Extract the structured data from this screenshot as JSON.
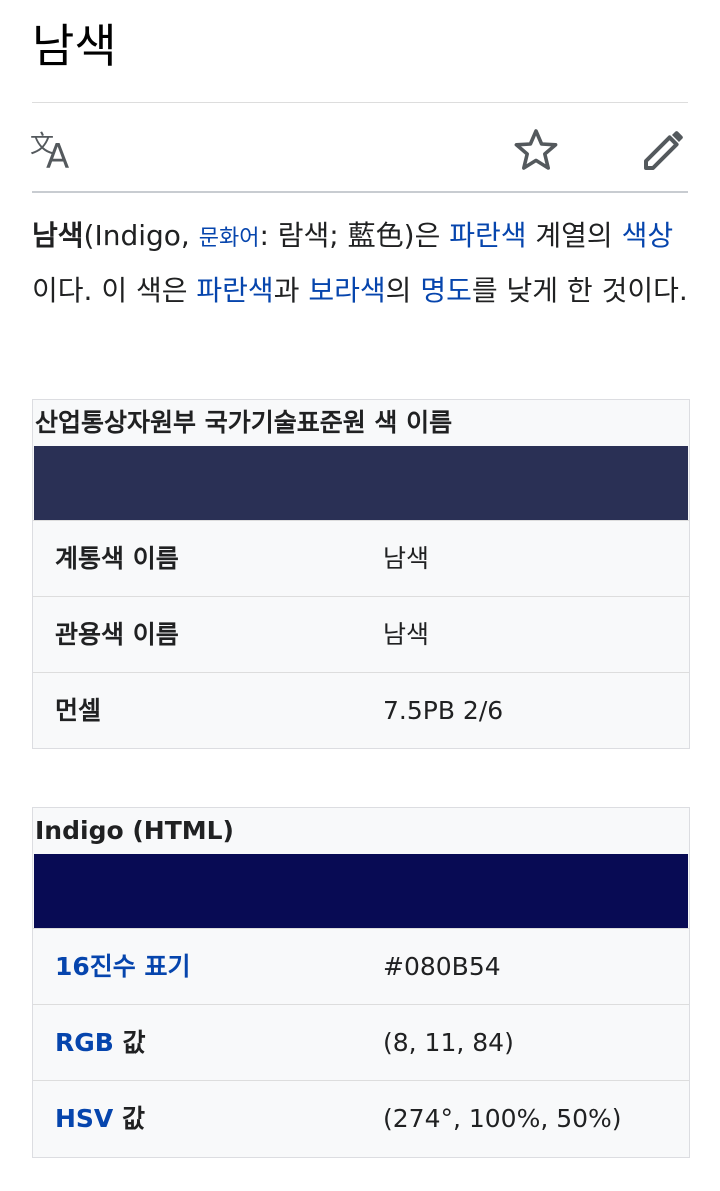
{
  "page": {
    "title": "남색"
  },
  "toolbar": {
    "language_icon": "translate-icon",
    "watch_icon": "star-icon",
    "edit_icon": "pencil-icon"
  },
  "intro": {
    "term": "남색",
    "open": "(Indigo, ",
    "munhwa_label": "문화어",
    "colon": ": 람색; 藍色)은 ",
    "link_blue": "파란색",
    "t1": " 계열의 ",
    "link_hue": "색상",
    "t2": "이다. 이 색은 ",
    "link_blue2": "파란색",
    "t3": "과 ",
    "link_purple": "보라색",
    "t4": "의 ",
    "link_value": "명도",
    "t5": "를 낮게 한 것이다."
  },
  "infobox1": {
    "caption": "산업통상자원부 국가기술표준원 색 이름",
    "swatch_color": "#2a3055",
    "rows": [
      {
        "key": "계통색 이름",
        "value": "남색"
      },
      {
        "key": "관용색 이름",
        "value": "남색"
      },
      {
        "key": "먼셀",
        "value": "7.5PB 2/6"
      }
    ]
  },
  "infobox2": {
    "caption": "Indigo (HTML)",
    "swatch_color": "#080B54",
    "rows": [
      {
        "key_link": "16진수 표기",
        "key_rest": "",
        "value": "#080B54"
      },
      {
        "key_link": "RGB",
        "key_rest": " 값",
        "value": "(8, 11, 84)"
      },
      {
        "key_link": "HSV",
        "key_rest": " 값",
        "value": "(274°, 100%, 50%)"
      }
    ]
  },
  "colors": {
    "link": "#0645ad",
    "text": "#202122",
    "border": "#dcdde1"
  }
}
